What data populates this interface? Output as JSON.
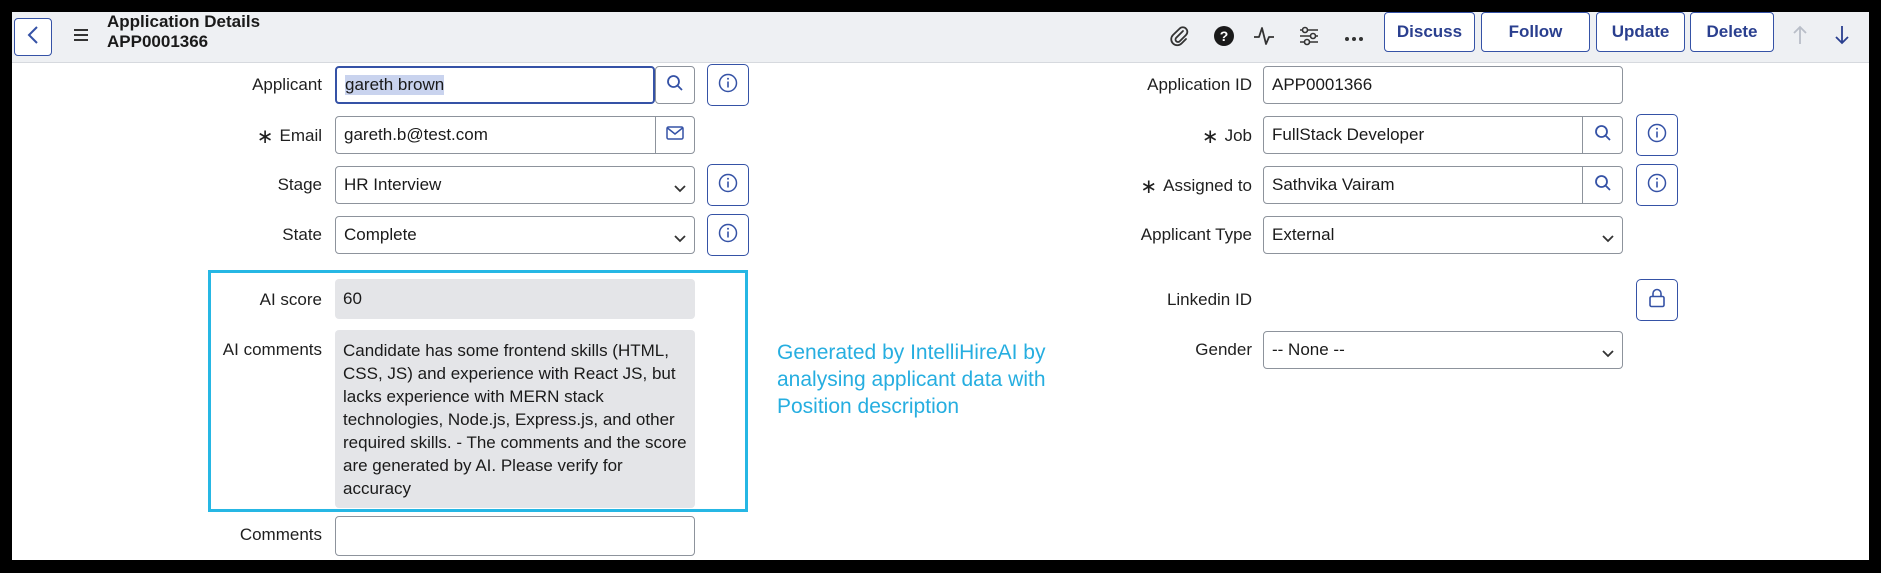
{
  "header": {
    "title": "Application Details",
    "record_number": "APP0001366",
    "buttons": {
      "discuss": "Discuss",
      "follow": "Follow",
      "update": "Update",
      "delete": "Delete"
    }
  },
  "form": {
    "applicant": {
      "label": "Applicant",
      "value": "gareth brown"
    },
    "email": {
      "label": "Email",
      "value": "gareth.b@test.com"
    },
    "stage": {
      "label": "Stage",
      "value": "HR Interview"
    },
    "state": {
      "label": "State",
      "value": "Complete"
    },
    "ai_score": {
      "label": "AI score",
      "value": "60"
    },
    "ai_comments": {
      "label": "AI comments",
      "value": "Candidate has some frontend skills (HTML, CSS, JS) and experience with React JS, but lacks experience with MERN stack technologies, Node.js, Express.js, and other required skills. - The comments and the score are generated by AI. Please verify for accuracy"
    },
    "comments": {
      "label": "Comments",
      "value": ""
    },
    "application_id": {
      "label": "Application ID",
      "value": "APP0001366"
    },
    "job": {
      "label": "Job",
      "value": "FullStack Developer"
    },
    "assigned_to": {
      "label": "Assigned to",
      "value": "Sathvika Vairam"
    },
    "applicant_type": {
      "label": "Applicant Type",
      "value": "External"
    },
    "linkedin_id": {
      "label": "Linkedin ID",
      "value": ""
    },
    "gender": {
      "label": "Gender",
      "value": "-- None --"
    }
  },
  "annotation": {
    "text": "Generated by IntelliHireAI by analysing applicant data with Position description"
  },
  "colors": {
    "accent": "#3552a6",
    "annotation": "#26b7e4",
    "readonly_bg": "#e4e5e8"
  },
  "icons": [
    "back-icon",
    "menu-icon",
    "paperclip-icon",
    "help-icon",
    "activity-icon",
    "settings-sliders-icon",
    "more-icon",
    "arrow-up-icon",
    "arrow-down-icon",
    "search-icon",
    "mail-icon",
    "info-icon",
    "chevron-down-icon",
    "lock-icon"
  ]
}
